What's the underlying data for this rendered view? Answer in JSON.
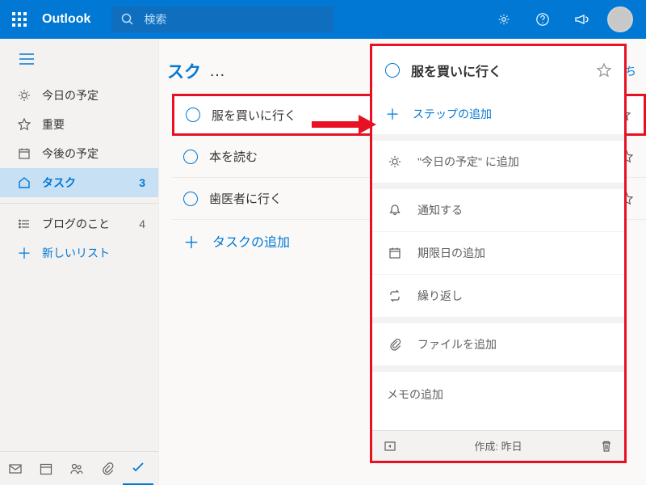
{
  "header": {
    "app_name": "Outlook",
    "search_placeholder": "検索"
  },
  "sidebar": {
    "items": [
      {
        "icon": "sun",
        "label": "今日の予定"
      },
      {
        "icon": "star",
        "label": "重要"
      },
      {
        "icon": "calendar",
        "label": "今後の予定"
      },
      {
        "icon": "home",
        "label": "タスク",
        "count": "3",
        "active": true
      }
    ],
    "custom": [
      {
        "label": "ブログのこと",
        "count": "4"
      }
    ],
    "new_list": "新しいリスト"
  },
  "list": {
    "title_fragment": "スク",
    "new_label": "新しいち",
    "tasks": [
      {
        "label": "服を買いに行く",
        "highlighted": true
      },
      {
        "label": "本を読む"
      },
      {
        "label": "歯医者に行く"
      }
    ],
    "add_task": "タスクの追加"
  },
  "detail": {
    "title": "服を買いに行く",
    "add_step": "ステップの追加",
    "add_today": "\"今日の予定\" に追加",
    "remind": "通知する",
    "due": "期限日の追加",
    "repeat": "繰り返し",
    "file": "ファイルを追加",
    "note": "メモの追加",
    "created": "作成: 昨日"
  }
}
